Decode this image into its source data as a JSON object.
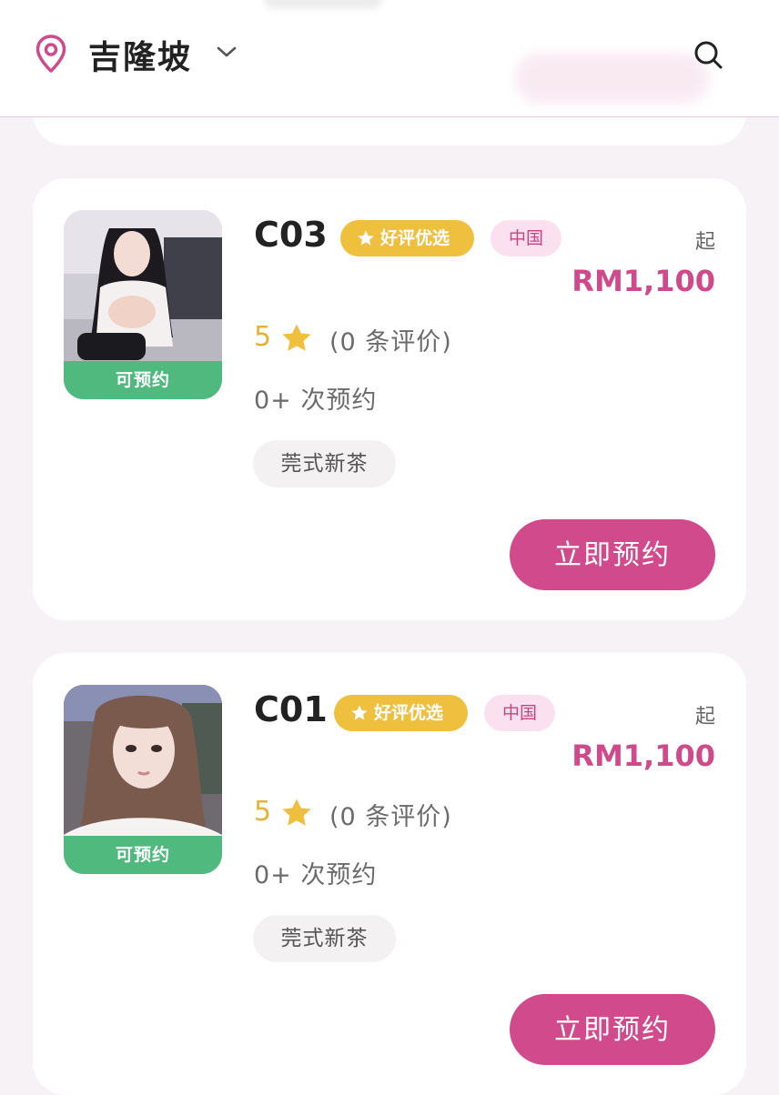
{
  "header": {
    "city": "吉隆坡"
  },
  "colors": {
    "accent": "#d14a8b",
    "price": "#cf4a8b",
    "available": "#4fb97e",
    "badge_good": "#efbf3e",
    "badge_cn_bg": "#fbe1ef",
    "rating": "#e4b33a"
  },
  "icons": {
    "location": "location-pin-icon",
    "dropdown": "chevron-down-icon",
    "search": "search-icon",
    "star": "star-icon"
  },
  "listings": [
    {
      "code": "C03",
      "availability": "可预约",
      "badge_good": "好评优选",
      "badge_region": "中国",
      "price_prefix": "起",
      "price": "RM1,100",
      "rating": "5",
      "reviews": "(0 条评价)",
      "bookings": "0+ 次预约",
      "tag": "莞式新茶",
      "book_label": "立即预约"
    },
    {
      "code": "C01",
      "availability": "可预约",
      "badge_good": "好评优选",
      "badge_region": "中国",
      "price_prefix": "起",
      "price": "RM1,100",
      "rating": "5",
      "reviews": "(0 条评价)",
      "bookings": "0+ 次预约",
      "tag": "莞式新茶",
      "book_label": "立即预约"
    }
  ]
}
